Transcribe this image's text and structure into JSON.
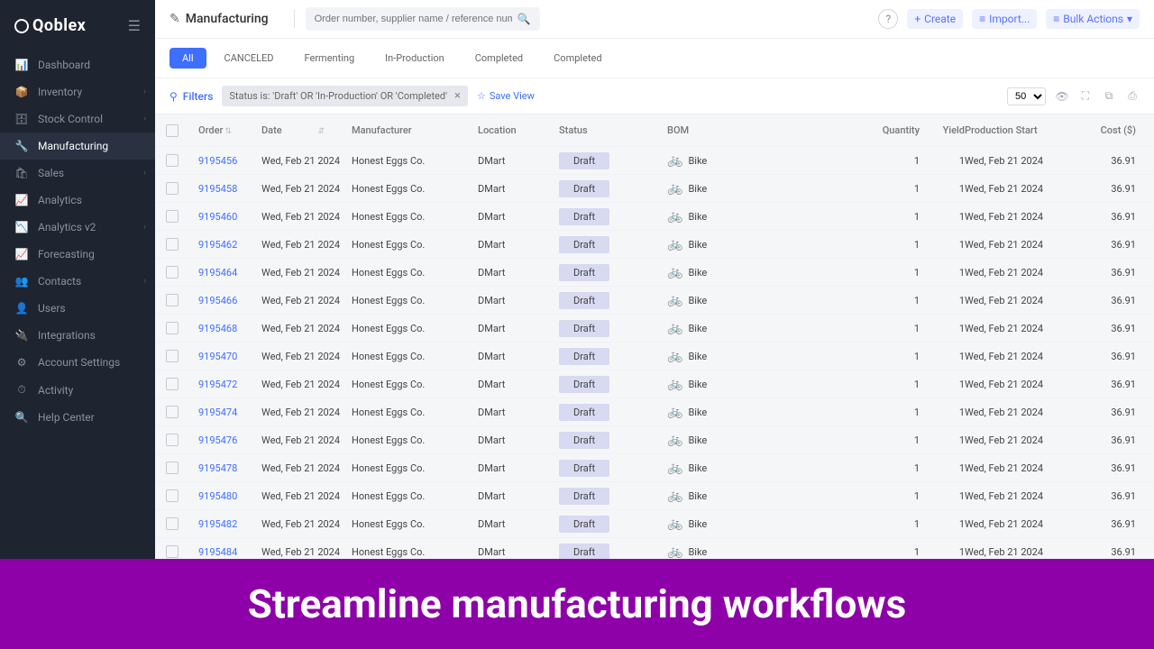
{
  "brand": "Qoblex",
  "page_title": "Manufacturing",
  "search": {
    "placeholder": "Order number, supplier name / reference number"
  },
  "top_actions": {
    "create": "Create",
    "import": "Import...",
    "bulk": "Bulk Actions"
  },
  "sidebar": {
    "items": [
      {
        "icon": "📊",
        "label": "Dashboard",
        "expand": false
      },
      {
        "icon": "📦",
        "label": "Inventory",
        "expand": true
      },
      {
        "icon": "🗄",
        "label": "Stock Control",
        "expand": true
      },
      {
        "icon": "🔧",
        "label": "Manufacturing",
        "expand": false,
        "active": true
      },
      {
        "icon": "🛍",
        "label": "Sales",
        "expand": true
      },
      {
        "icon": "📈",
        "label": "Analytics",
        "expand": false
      },
      {
        "icon": "📉",
        "label": "Analytics v2",
        "expand": true
      },
      {
        "icon": "📈",
        "label": "Forecasting",
        "expand": false
      },
      {
        "icon": "👥",
        "label": "Contacts",
        "expand": true
      },
      {
        "icon": "👤",
        "label": "Users",
        "expand": false
      },
      {
        "icon": "🔌",
        "label": "Integrations",
        "expand": false
      },
      {
        "icon": "⚙",
        "label": "Account Settings",
        "expand": false
      },
      {
        "icon": "⏱",
        "label": "Activity",
        "expand": false
      },
      {
        "icon": "🔍",
        "label": "Help Center",
        "expand": false
      }
    ]
  },
  "tabs": [
    {
      "label": "All",
      "active": true
    },
    {
      "label": "CANCELED"
    },
    {
      "label": "Fermenting"
    },
    {
      "label": "In-Production"
    },
    {
      "label": "Completed"
    },
    {
      "label": "Completed"
    }
  ],
  "filters": {
    "label": "Filters",
    "chip": "Status is: 'Draft' OR 'In-Production' OR 'Completed'",
    "save_view": "Save View",
    "page_size": "50"
  },
  "columns": {
    "order": "Order",
    "date": "Date",
    "manufacturer": "Manufacturer",
    "location": "Location",
    "status": "Status",
    "bom": "BOM",
    "quantity": "Quantity",
    "yield": "Yield",
    "production_start": "Production Start",
    "cost": "Cost ($)"
  },
  "rows": [
    {
      "order": "9195456",
      "date": "Wed, Feb 21 2024",
      "manufacturer": "Honest Eggs Co.",
      "location": "DMart",
      "status": "Draft",
      "bom": "Bike",
      "quantity": "1",
      "yield": "1",
      "start": "Wed, Feb 21 2024",
      "cost": "36.91"
    },
    {
      "order": "9195458",
      "date": "Wed, Feb 21 2024",
      "manufacturer": "Honest Eggs Co.",
      "location": "DMart",
      "status": "Draft",
      "bom": "Bike",
      "quantity": "1",
      "yield": "1",
      "start": "Wed, Feb 21 2024",
      "cost": "36.91"
    },
    {
      "order": "9195460",
      "date": "Wed, Feb 21 2024",
      "manufacturer": "Honest Eggs Co.",
      "location": "DMart",
      "status": "Draft",
      "bom": "Bike",
      "quantity": "1",
      "yield": "1",
      "start": "Wed, Feb 21 2024",
      "cost": "36.91"
    },
    {
      "order": "9195462",
      "date": "Wed, Feb 21 2024",
      "manufacturer": "Honest Eggs Co.",
      "location": "DMart",
      "status": "Draft",
      "bom": "Bike",
      "quantity": "1",
      "yield": "1",
      "start": "Wed, Feb 21 2024",
      "cost": "36.91"
    },
    {
      "order": "9195464",
      "date": "Wed, Feb 21 2024",
      "manufacturer": "Honest Eggs Co.",
      "location": "DMart",
      "status": "Draft",
      "bom": "Bike",
      "quantity": "1",
      "yield": "1",
      "start": "Wed, Feb 21 2024",
      "cost": "36.91"
    },
    {
      "order": "9195466",
      "date": "Wed, Feb 21 2024",
      "manufacturer": "Honest Eggs Co.",
      "location": "DMart",
      "status": "Draft",
      "bom": "Bike",
      "quantity": "1",
      "yield": "1",
      "start": "Wed, Feb 21 2024",
      "cost": "36.91"
    },
    {
      "order": "9195468",
      "date": "Wed, Feb 21 2024",
      "manufacturer": "Honest Eggs Co.",
      "location": "DMart",
      "status": "Draft",
      "bom": "Bike",
      "quantity": "1",
      "yield": "1",
      "start": "Wed, Feb 21 2024",
      "cost": "36.91"
    },
    {
      "order": "9195470",
      "date": "Wed, Feb 21 2024",
      "manufacturer": "Honest Eggs Co.",
      "location": "DMart",
      "status": "Draft",
      "bom": "Bike",
      "quantity": "1",
      "yield": "1",
      "start": "Wed, Feb 21 2024",
      "cost": "36.91"
    },
    {
      "order": "9195472",
      "date": "Wed, Feb 21 2024",
      "manufacturer": "Honest Eggs Co.",
      "location": "DMart",
      "status": "Draft",
      "bom": "Bike",
      "quantity": "1",
      "yield": "1",
      "start": "Wed, Feb 21 2024",
      "cost": "36.91"
    },
    {
      "order": "9195474",
      "date": "Wed, Feb 21 2024",
      "manufacturer": "Honest Eggs Co.",
      "location": "DMart",
      "status": "Draft",
      "bom": "Bike",
      "quantity": "1",
      "yield": "1",
      "start": "Wed, Feb 21 2024",
      "cost": "36.91"
    },
    {
      "order": "9195476",
      "date": "Wed, Feb 21 2024",
      "manufacturer": "Honest Eggs Co.",
      "location": "DMart",
      "status": "Draft",
      "bom": "Bike",
      "quantity": "1",
      "yield": "1",
      "start": "Wed, Feb 21 2024",
      "cost": "36.91"
    },
    {
      "order": "9195478",
      "date": "Wed, Feb 21 2024",
      "manufacturer": "Honest Eggs Co.",
      "location": "DMart",
      "status": "Draft",
      "bom": "Bike",
      "quantity": "1",
      "yield": "1",
      "start": "Wed, Feb 21 2024",
      "cost": "36.91"
    },
    {
      "order": "9195480",
      "date": "Wed, Feb 21 2024",
      "manufacturer": "Honest Eggs Co.",
      "location": "DMart",
      "status": "Draft",
      "bom": "Bike",
      "quantity": "1",
      "yield": "1",
      "start": "Wed, Feb 21 2024",
      "cost": "36.91"
    },
    {
      "order": "9195482",
      "date": "Wed, Feb 21 2024",
      "manufacturer": "Honest Eggs Co.",
      "location": "DMart",
      "status": "Draft",
      "bom": "Bike",
      "quantity": "1",
      "yield": "1",
      "start": "Wed, Feb 21 2024",
      "cost": "36.91"
    },
    {
      "order": "9195484",
      "date": "Wed, Feb 21 2024",
      "manufacturer": "Honest Eggs Co.",
      "location": "DMart",
      "status": "Draft",
      "bom": "Bike",
      "quantity": "1",
      "yield": "1",
      "start": "Wed, Feb 21 2024",
      "cost": "36.91"
    }
  ],
  "banner": "Streamline manufacturing workflows"
}
